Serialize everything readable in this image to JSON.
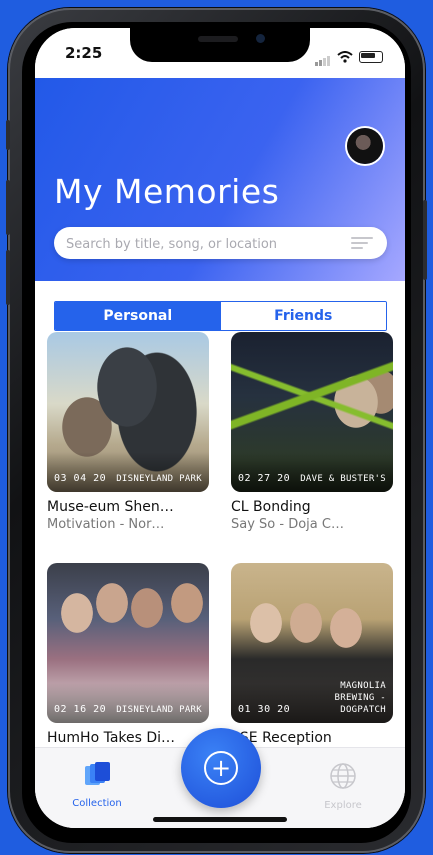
{
  "status_bar": {
    "time": "2:25"
  },
  "header": {
    "title": "My Memories",
    "search_placeholder": "Search by title, song, or location"
  },
  "tabs": [
    {
      "label": "Personal",
      "active": true
    },
    {
      "label": "Friends",
      "active": false
    }
  ],
  "memories": [
    {
      "title": "Muse-eum Shen…",
      "subtitle": "Motivation - Nor…",
      "date": "03 04 20",
      "location": "DISNEYLAND PARK"
    },
    {
      "title": "CL Bonding",
      "subtitle": "Say So - Doja C…",
      "date": "02 27 20",
      "location": "DAVE & BUSTER'S"
    },
    {
      "title": "HumHo Takes Di…",
      "subtitle": "",
      "date": "02 16 20",
      "location": "DISNEYLAND PARK"
    },
    {
      "title": "SSE Reception",
      "subtitle": "",
      "date": "01 30 20",
      "location": "MAGNOLIA BREWING - DOGPATCH"
    }
  ],
  "tab_bar": {
    "collection": {
      "label": "Collection",
      "icon": "collection-icon",
      "active": true
    },
    "add": {
      "icon": "plus-circle-icon"
    },
    "explore": {
      "label": "Explore",
      "icon": "globe-icon",
      "active": false
    }
  },
  "colors": {
    "accent": "#2563eb",
    "header_start": "#2259e8",
    "header_end": "#a6a8ff",
    "background": "#1f5de0"
  }
}
